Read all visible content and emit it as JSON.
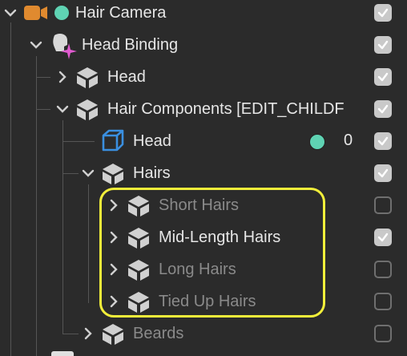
{
  "tree": {
    "hair_camera": {
      "label": "Hair Camera",
      "checked": true
    },
    "head_binding": {
      "label": "Head Binding",
      "checked": true
    },
    "head": {
      "label": "Head",
      "checked": true
    },
    "hair_components": {
      "label": "Hair Components [EDIT_CHILDF",
      "checked": true
    },
    "head_mesh": {
      "label": "Head",
      "value": "0",
      "checked": true
    },
    "hairs": {
      "label": "Hairs",
      "checked": true
    },
    "short_hairs": {
      "label": "Short Hairs",
      "checked": false
    },
    "mid_length_hairs": {
      "label": "Mid-Length Hairs",
      "checked": true
    },
    "long_hairs": {
      "label": "Long Hairs",
      "checked": false
    },
    "tied_up_hairs": {
      "label": "Tied Up Hairs",
      "checked": false
    },
    "beards": {
      "label": "Beards",
      "checked": false
    }
  },
  "colors": {
    "background": "#2b2b2b",
    "highlight": "#f2ef3a",
    "camera_icon": "#e08a2f",
    "status_dot": "#5fd3b3",
    "mesh_icon": "#3a8fe0",
    "checkbox_on": "#c9c9c9"
  }
}
